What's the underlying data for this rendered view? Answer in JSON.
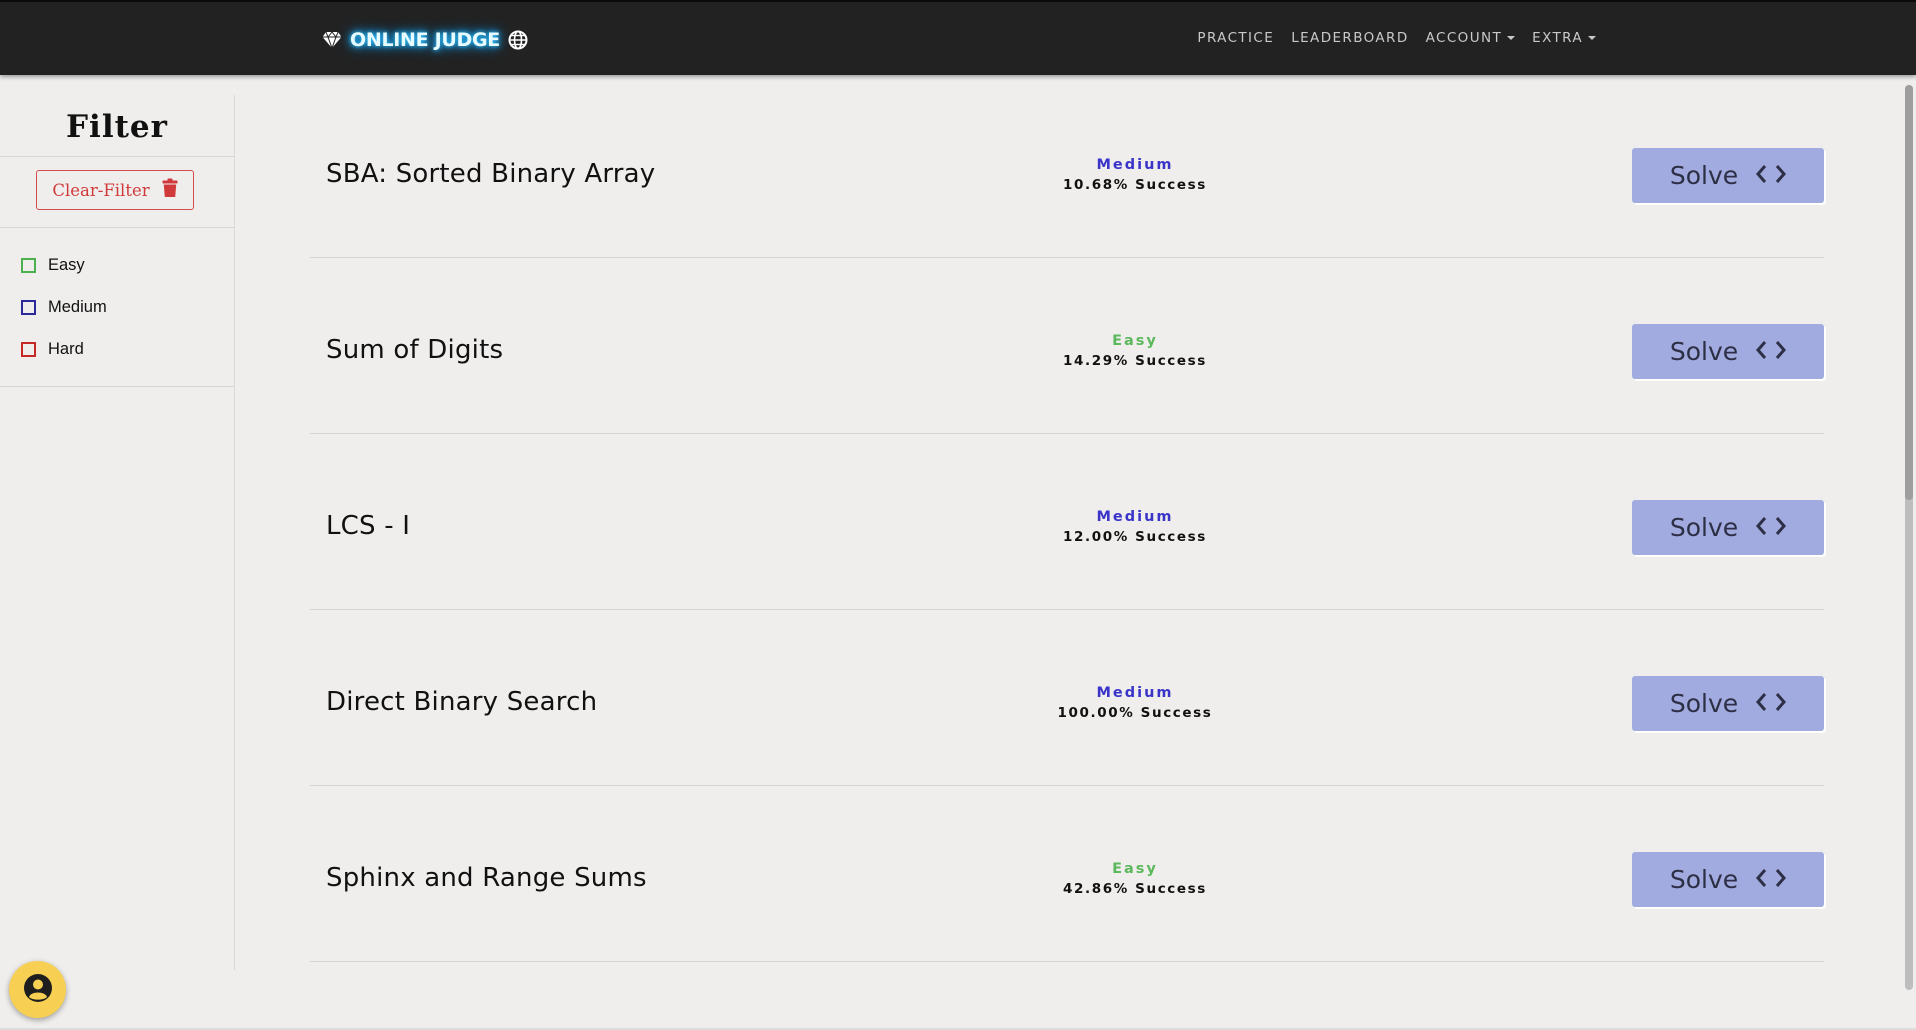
{
  "navbar": {
    "brand": "ONLINE JUDGE",
    "links": [
      {
        "label": "PRACTICE",
        "dropdown": false
      },
      {
        "label": "LEADERBOARD",
        "dropdown": false
      },
      {
        "label": "ACCOUNT",
        "dropdown": true
      },
      {
        "label": "EXTRA",
        "dropdown": true
      }
    ]
  },
  "sidebar": {
    "title": "Filter",
    "clear_label": "Clear-Filter",
    "filters": [
      {
        "label": "Easy",
        "color": "#4caf50"
      },
      {
        "label": "Medium",
        "color": "#2a2a9a"
      },
      {
        "label": "Hard",
        "color": "#c62828"
      }
    ]
  },
  "problems": [
    {
      "name": "SBA: Sorted Binary Array",
      "difficulty": "Medium",
      "success": "10.68% Success",
      "solve_label": "Solve"
    },
    {
      "name": "Sum of Digits",
      "difficulty": "Easy",
      "success": "14.29% Success",
      "solve_label": "Solve"
    },
    {
      "name": "LCS - I",
      "difficulty": "Medium",
      "success": "12.00% Success",
      "solve_label": "Solve"
    },
    {
      "name": "Direct Binary Search",
      "difficulty": "Medium",
      "success": "100.00% Success",
      "solve_label": "Solve"
    },
    {
      "name": "Sphinx and Range Sums",
      "difficulty": "Easy",
      "success": "42.86% Success",
      "solve_label": "Solve"
    }
  ],
  "colors": {
    "navbar_bg": "#222222",
    "brand_glow": "#34c6ff",
    "easy": "#5cb85c",
    "medium": "#3a34c9",
    "hard": "#c62828",
    "solve_bg": "#a1abe0",
    "clear_filter": "#d13a3a",
    "avatar_bg": "#f6cf53"
  },
  "icons": {
    "brand_left": "gem-icon",
    "brand_right": "globe-icon",
    "clear": "trash-icon",
    "solve": "code-icon",
    "avatar": "user-circle-icon"
  }
}
